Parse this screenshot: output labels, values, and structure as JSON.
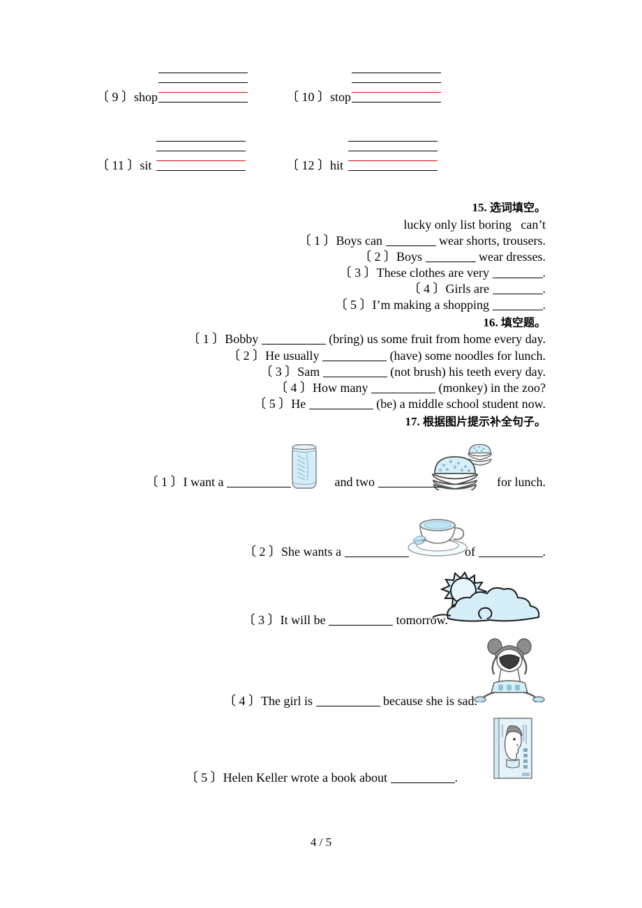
{
  "page": {
    "footer": "4 / 5"
  },
  "handwriting": {
    "items": [
      {
        "label": "〔 9 〕shop"
      },
      {
        "label": "〔 10 〕stop"
      },
      {
        "label": "〔 11 〕sit"
      },
      {
        "label": "〔 12 〕hit"
      }
    ],
    "red_line_color": "#e8000d"
  },
  "section15": {
    "heading_num": "15.",
    "heading_cn": "选词填空。",
    "wordbank": "lucky only list boring   can’t",
    "items": [
      {
        "no": "〔 1 〕",
        "before": "Boys can ",
        "after": " wear shorts, trousers."
      },
      {
        "no": "〔 2 〕",
        "before": "Boys ",
        "after": " wear dresses."
      },
      {
        "no": "〔 3 〕",
        "before": "These clothes are very ",
        "after": "."
      },
      {
        "no": "〔 4 〕",
        "before": "Girls are ",
        "after": "."
      },
      {
        "no": "〔 5 〕",
        "before": "I’m making a shopping ",
        "after": "."
      }
    ]
  },
  "section16": {
    "heading_num": "16.",
    "heading_cn": "填空题。",
    "items": [
      {
        "no": "〔 1 〕",
        "before": "Bobby ",
        "after": " (bring) us some fruit from home every day."
      },
      {
        "no": "〔 2 〕",
        "before": "He usually ",
        "after": " (have) some noodles for lunch."
      },
      {
        "no": "〔 3 〕",
        "before": "Sam ",
        "after": " (not brush) his teeth every day."
      },
      {
        "no": "〔 4 〕",
        "before": "How many ",
        "after": " (monkey) in the zoo?"
      },
      {
        "no": "〔 5 〕",
        "before": "He ",
        "after": " (be) a middle school student now."
      }
    ]
  },
  "section17": {
    "heading_num": "17.",
    "heading_cn": "根据图片提示补全句子。",
    "items": [
      {
        "no": "〔 1 〕",
        "part1": "I want a ",
        "part2": " and two ",
        "part3": " for lunch.",
        "image1": "soda-can-illustration",
        "image2": "hamburgers-illustration"
      },
      {
        "no": "〔 2 〕",
        "part1": "She wants a ",
        "part2": " of ",
        "part3": ".",
        "image1": "teacup-illustration"
      },
      {
        "no": "〔 3 〕",
        "part1": "It will be ",
        "part2": " tomorrow.",
        "image1": "sun-behind-clouds-illustration"
      },
      {
        "no": "〔 4 〕",
        "part1": "The girl is ",
        "part2": " because she is sad.",
        "image1": "crying-girl-illustration"
      },
      {
        "no": "〔 5 〕",
        "part1": "Helen Keller wrote a book about ",
        "part2": ".",
        "image1": "book-cover-illustration"
      }
    ]
  },
  "colors": {
    "illustration_fill": "#d6eef8",
    "illustration_stroke": "#4a4a4a",
    "red_rule": "#e8000d"
  }
}
